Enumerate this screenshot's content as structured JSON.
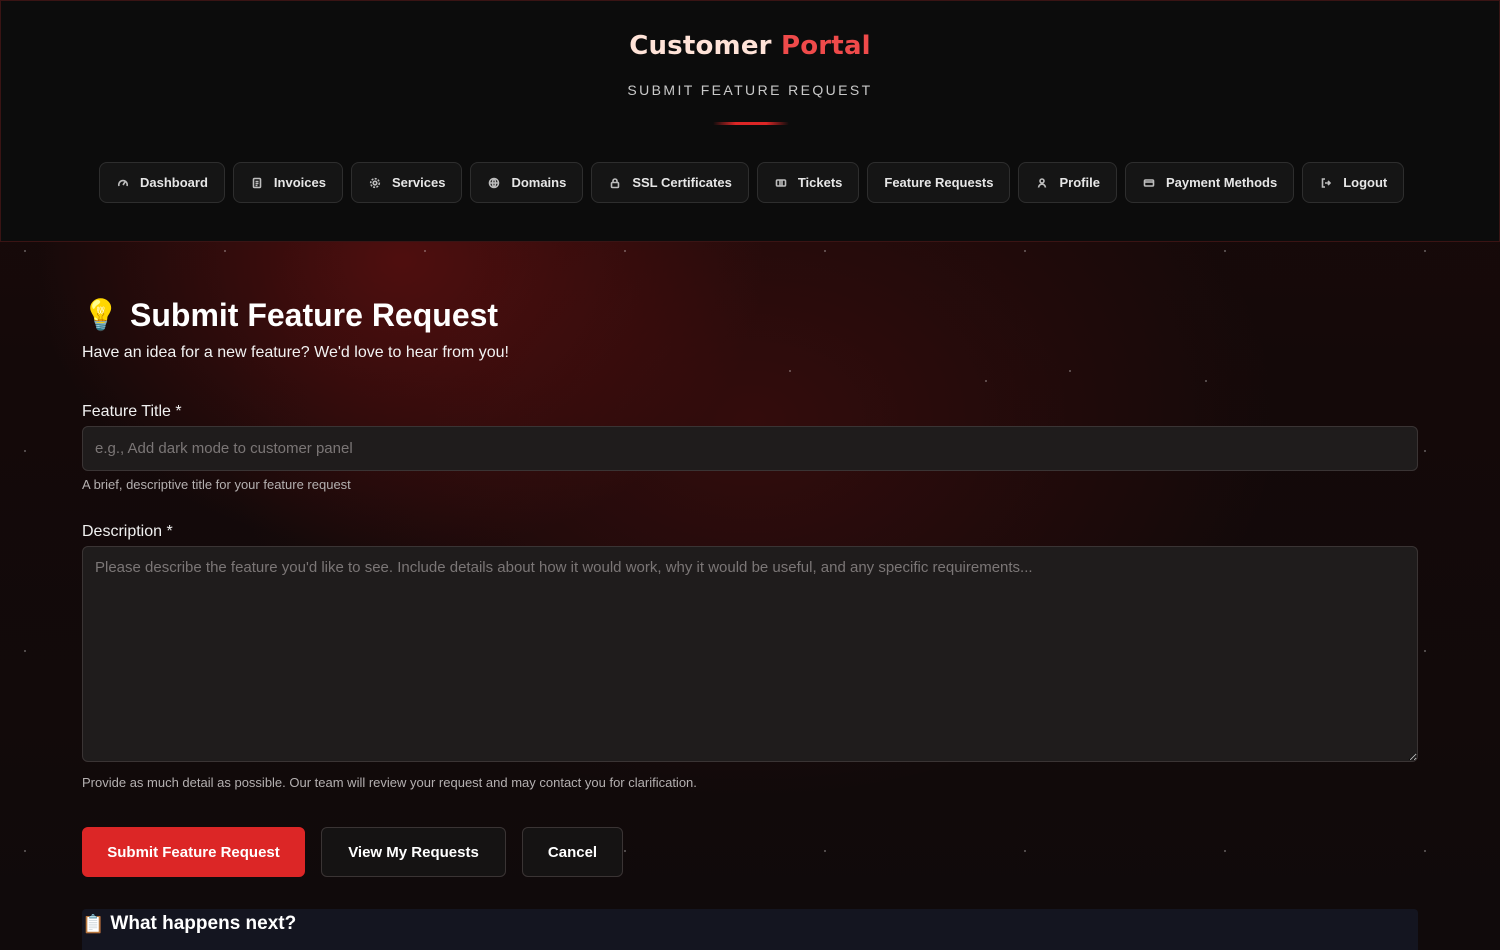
{
  "header": {
    "brand_word1": "Customer",
    "brand_word2": "Portal",
    "subtitle": "SUBMIT FEATURE REQUEST",
    "accent_color": "#dc2626"
  },
  "nav": {
    "items": [
      {
        "label": "Dashboard",
        "icon": "gauge-icon"
      },
      {
        "label": "Invoices",
        "icon": "invoice-icon"
      },
      {
        "label": "Services",
        "icon": "gear-icon"
      },
      {
        "label": "Domains",
        "icon": "globe-icon"
      },
      {
        "label": "SSL Certificates",
        "icon": "lock-icon"
      },
      {
        "label": "Tickets",
        "icon": "ticket-icon"
      },
      {
        "label": "Feature Requests",
        "icon": ""
      },
      {
        "label": "Profile",
        "icon": "user-icon"
      },
      {
        "label": "Payment Methods",
        "icon": "credit-card-icon"
      },
      {
        "label": "Logout",
        "icon": "logout-icon"
      }
    ]
  },
  "page": {
    "title_emoji": "💡",
    "title": "Submit Feature Request",
    "lead": "Have an idea for a new feature? We'd love to hear from you!"
  },
  "form": {
    "title_label": "Feature Title *",
    "title_value": "",
    "title_placeholder": "e.g., Add dark mode to customer panel",
    "title_hint": "A brief, descriptive title for your feature request",
    "description_label": "Description *",
    "description_value": "",
    "description_placeholder": "Please describe the feature you'd like to see. Include details about how it would work, why it would be useful, and any specific requirements...",
    "description_hint": "Provide as much detail as possible. Our team will review your request and may contact you for clarification."
  },
  "actions": {
    "submit_label": "Submit Feature Request",
    "view_label": "View My Requests",
    "cancel_label": "Cancel"
  },
  "next": {
    "emoji": "📋",
    "title": "What happens next?"
  }
}
